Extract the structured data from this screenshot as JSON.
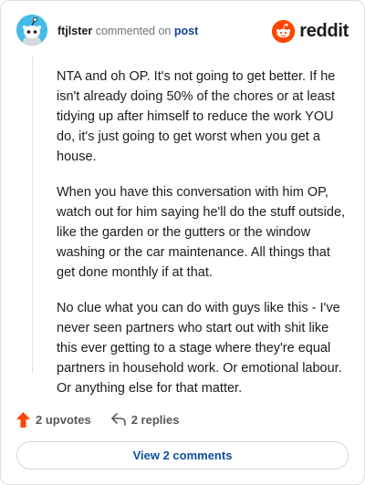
{
  "header": {
    "username": "ftjlster",
    "action_text": "commented on",
    "target_text": "post",
    "brand_name": "reddit"
  },
  "comment": {
    "paragraphs": [
      "NTA and oh OP. It's not going to get better. If he isn't already doing 50% of the chores or at least tidying up after himself to reduce the work YOU do, it's just going to get worst when you get a house.",
      "When you have this conversation with him OP, watch out for him saying he'll do the stuff outside, like the garden or the gutters or the window washing or the car maintenance. All things that get done monthly if at that.",
      "No clue what you can do with guys like this - I've never seen partners who start out with shit like this ever getting to a stage where they're equal partners in household work. Or emotional labour. Or anything else for that matter."
    ]
  },
  "actions": {
    "upvotes": "2 upvotes",
    "replies": "2 replies"
  },
  "footer": {
    "view_comments": "View 2 comments"
  },
  "colors": {
    "brand": "#ff4500",
    "avatar_bg": "#45bce8",
    "link": "#0a449b"
  },
  "icons": {
    "avatar": "snoo-avatar-icon",
    "brand": "reddit-logo-icon",
    "upvote": "upvote-arrow-icon",
    "reply": "reply-arrow-icon"
  }
}
